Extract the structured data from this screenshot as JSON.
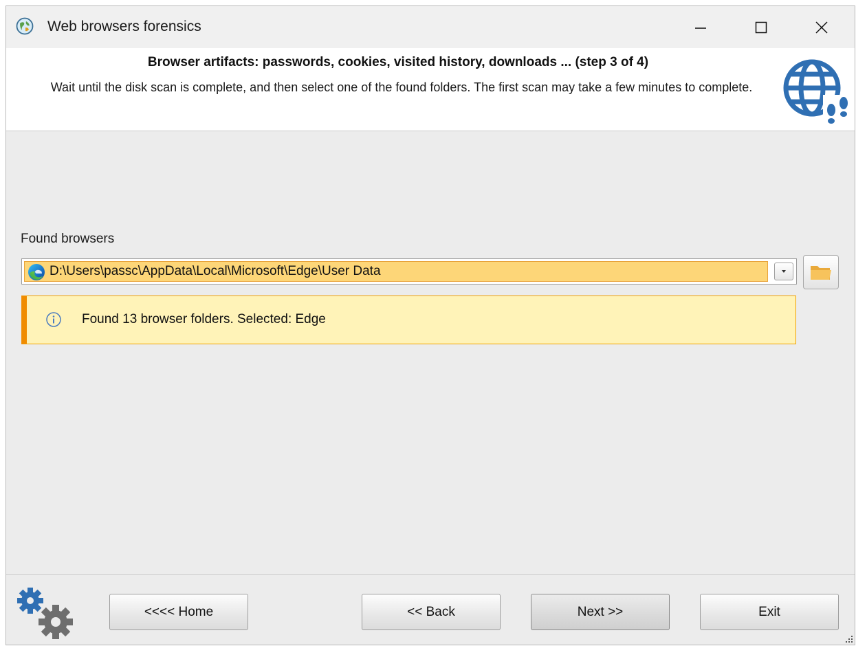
{
  "window": {
    "title": "Web browsers forensics",
    "controls": {
      "minimize": "—",
      "maximize": "☐",
      "close": "✕"
    }
  },
  "header": {
    "title": "Browser artifacts: passwords, cookies, visited history, downloads ... (step 3 of 4)",
    "description": "Wait until the disk scan is complete, and then select one of the found folders. The first scan may take a few minutes  to complete.",
    "icon": "globe-footprints-icon"
  },
  "main": {
    "found_browsers_label": "Found browsers",
    "selected_browser_path": "D:\\Users\\passc\\AppData\\Local\\Microsoft\\Edge\\User Data",
    "selected_browser_icon": "edge-icon",
    "info_message": "Found 13 browser folders. Selected: Edge"
  },
  "footer": {
    "home_label": "<<<< Home",
    "back_label": "<< Back",
    "next_label": "Next >>",
    "exit_label": "Exit"
  },
  "colors": {
    "accent": "#2f6fb3",
    "combo_highlight": "#fdd678",
    "info_bg": "#fff3b8",
    "info_border": "#f08c00"
  }
}
